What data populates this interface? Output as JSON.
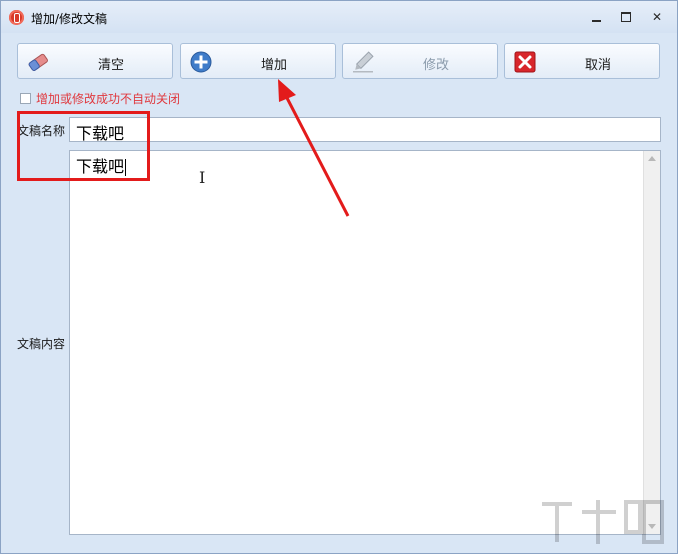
{
  "window": {
    "title": "增加/修改文稿"
  },
  "toolbar": {
    "clear_label": "清空",
    "add_label": "增加",
    "edit_label": "修改",
    "cancel_label": "取消"
  },
  "options": {
    "no_autoclose_label": "增加或修改成功不自动关闭",
    "no_autoclose_checked": false
  },
  "form": {
    "name_label": "文稿名称",
    "name_value": "下载吧",
    "content_label": "文稿内容",
    "content_value": "下载吧"
  },
  "colors": {
    "annotation": "#e31b1b",
    "warning_text": "#e0393e"
  }
}
